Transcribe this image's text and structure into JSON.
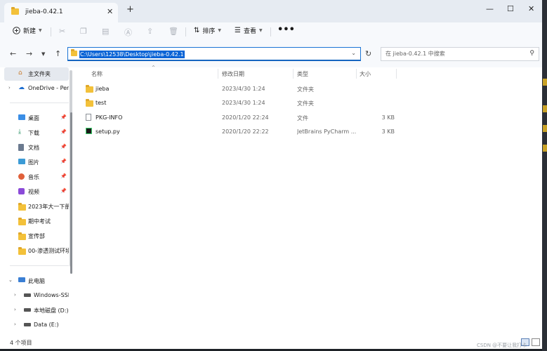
{
  "window": {
    "tab_title": "jieba-0.42.1",
    "tab_close": "✕",
    "new_tab": "+",
    "minimize": "—",
    "maximize": "☐",
    "close": "✕"
  },
  "toolbar": {
    "new_label": "新建",
    "sort_label": "排序",
    "view_label": "查看",
    "more": "•••",
    "icons": [
      "cut-icon",
      "copy-icon",
      "paste-icon",
      "rename-icon",
      "share-icon",
      "delete-icon"
    ]
  },
  "address": {
    "path": "C:\\Users\\12538\\Desktop\\jieba-0.42.1",
    "search_placeholder": "在 jieba-0.42.1 中搜索"
  },
  "sidebar": {
    "top": [
      {
        "label": "主文件夹",
        "icon": "home-icon",
        "selected": true
      },
      {
        "label": "OneDrive - Per",
        "icon": "cloud-icon",
        "expand": true
      }
    ],
    "quick_access": [
      {
        "label": "桌面",
        "icon": "desktop-icon",
        "pinned": true
      },
      {
        "label": "下载",
        "icon": "download-icon",
        "pinned": true
      },
      {
        "label": "文档",
        "icon": "document-icon",
        "pinned": true
      },
      {
        "label": "图片",
        "icon": "pictures-icon",
        "pinned": true
      },
      {
        "label": "音乐",
        "icon": "music-icon",
        "pinned": true
      },
      {
        "label": "视频",
        "icon": "video-icon",
        "pinned": true
      },
      {
        "label": "2023年大一下册",
        "icon": "folder-icon"
      },
      {
        "label": "期中考试",
        "icon": "folder-icon"
      },
      {
        "label": "宣传部",
        "icon": "folder-icon"
      },
      {
        "label": "00-渗透测试环境",
        "icon": "folder-icon"
      }
    ],
    "this_pc": {
      "label": "此电脑",
      "icon": "pc-icon"
    },
    "drives": [
      {
        "label": "Windows-SSD",
        "icon": "drive-icon"
      },
      {
        "label": "本地磁盘 (D:)",
        "icon": "drive-icon"
      },
      {
        "label": "Data (E:)",
        "icon": "drive-icon"
      }
    ]
  },
  "columns": {
    "name": "名称",
    "date": "修改日期",
    "type": "类型",
    "size": "大小"
  },
  "files": [
    {
      "name": "jieba",
      "date": "2023/4/30 1:24",
      "type": "文件夹",
      "size": "",
      "icon": "folder-icon"
    },
    {
      "name": "test",
      "date": "2023/4/30 1:24",
      "type": "文件夹",
      "size": "",
      "icon": "folder-icon"
    },
    {
      "name": "PKG-INFO",
      "date": "2020/1/20 22:24",
      "type": "文件",
      "size": "3 KB",
      "icon": "file-icon"
    },
    {
      "name": "setup.py",
      "date": "2020/1/20 22:22",
      "type": "JetBrains PyCharm ...",
      "size": "3 KB",
      "icon": "pycharm-file-icon"
    }
  ],
  "status": {
    "item_count": "4 个项目"
  },
  "watermark": "CSDN @不要让我打卡"
}
